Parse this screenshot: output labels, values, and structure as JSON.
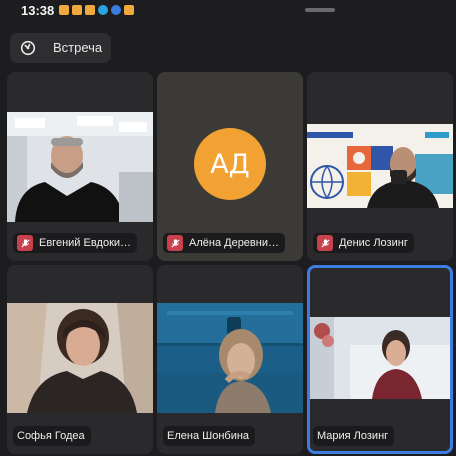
{
  "status_bar": {
    "time": "13:38",
    "notification_icons": [
      "app-icon",
      "app-icon",
      "app-icon",
      "telegram-icon",
      "mail-icon",
      "mail-icon"
    ]
  },
  "header": {
    "meeting_label": "Встреча"
  },
  "participants": [
    {
      "name": "Евгений Евдоки…",
      "muted": true
    },
    {
      "name": "Алёна Деревни…",
      "muted": true,
      "initials": "АД",
      "avatar_color": "#f2a233"
    },
    {
      "name": "Денис Лозинг",
      "muted": true
    },
    {
      "name": "Софья Годеа",
      "muted": false
    },
    {
      "name": "Елена Шонбина",
      "muted": false
    },
    {
      "name": "Мария Лозинг",
      "muted": false,
      "active_speaker": true
    }
  ],
  "colors": {
    "background": "#1d1d1f",
    "tile": "#2a2a2d",
    "mic_muted": "#c8414c",
    "active_border": "#3d7ce0"
  }
}
